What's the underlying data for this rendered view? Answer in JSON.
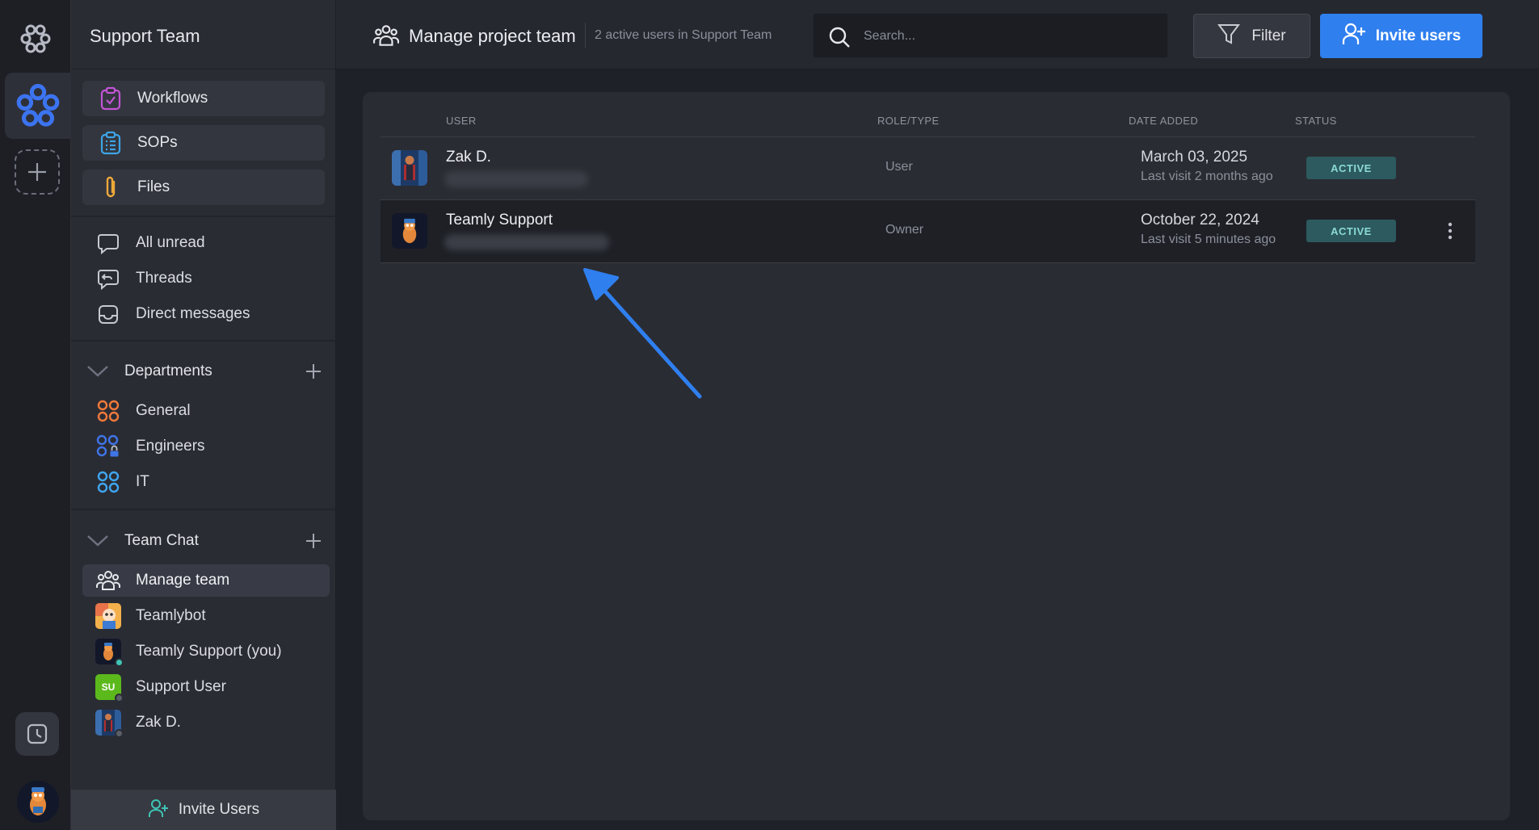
{
  "sidebar": {
    "team_name": "Support Team",
    "cards": [
      {
        "label": "Workflows",
        "icon": "clipboard-check-icon"
      },
      {
        "label": "SOPs",
        "icon": "clipboard-list-icon"
      },
      {
        "label": "Files",
        "icon": "paperclip-icon"
      }
    ],
    "inbox": [
      {
        "label": "All unread",
        "icon": "chat-bubble-icon"
      },
      {
        "label": "Threads",
        "icon": "thread-icon"
      },
      {
        "label": "Direct messages",
        "icon": "inbox-icon"
      }
    ],
    "departments": {
      "title": "Departments",
      "items": [
        {
          "label": "General",
          "color": "#f07a3a"
        },
        {
          "label": "Engineers",
          "color": "#3f74e8"
        },
        {
          "label": "IT",
          "color": "#3fa6f0"
        }
      ]
    },
    "team_chat": {
      "title": "Team Chat",
      "items": [
        {
          "label": "Manage team"
        },
        {
          "label": "Teamlybot"
        },
        {
          "label": "Teamly Support (you)"
        },
        {
          "label": "Support User",
          "initials": "SU"
        },
        {
          "label": "Zak D."
        }
      ]
    },
    "invite_label": "Invite Users"
  },
  "header": {
    "title": "Manage project team",
    "subtitle": "2 active users in Support Team",
    "search_placeholder": "Search...",
    "filter_label": "Filter",
    "invite_label": "Invite users"
  },
  "table": {
    "columns": [
      "USER",
      "ROLE/TYPE",
      "DATE ADDED",
      "STATUS"
    ],
    "rows": [
      {
        "name": "Zak D.",
        "role": "User",
        "date": "March 03, 2025",
        "visit": "Last visit 2 months ago",
        "status": "ACTIVE"
      },
      {
        "name": "Teamly Support",
        "role": "Owner",
        "date": "October 22, 2024",
        "visit": "Last visit 5 minutes ago",
        "status": "ACTIVE"
      }
    ]
  },
  "colors": {
    "accent": "#2f7fef",
    "badge_bg": "#2c5a5f",
    "badge_text": "#8cd9d6",
    "online": "#3fc4b5"
  }
}
